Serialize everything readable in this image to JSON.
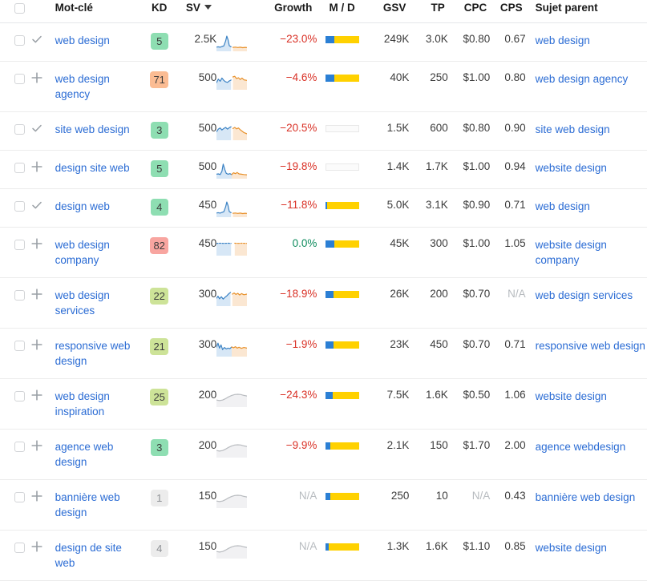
{
  "header": {
    "columns": [
      {
        "key": "keyword",
        "label": "Mot-clé"
      },
      {
        "key": "kd",
        "label": "KD"
      },
      {
        "key": "sv",
        "label": "SV"
      },
      {
        "key": "growth",
        "label": "Growth"
      },
      {
        "key": "md",
        "label": "M / D"
      },
      {
        "key": "gsv",
        "label": "GSV"
      },
      {
        "key": "tp",
        "label": "TP"
      },
      {
        "key": "cpc",
        "label": "CPC"
      },
      {
        "key": "cps",
        "label": "CPS"
      },
      {
        "key": "parent",
        "label": "Sujet parent"
      }
    ],
    "sort_column": "SV",
    "sort_direction": "desc",
    "select_all_checked": false
  },
  "colors": {
    "link": "#2b6cd4",
    "growth_negative": "#d93025",
    "growth_zero": "#0b8a5b",
    "na_text": "#b7bbbf",
    "kd_easy": "#8edeb2",
    "kd_medium_light": "#cde398",
    "kd_hard": "#fbbc93",
    "kd_very_hard": "#f8a5a0",
    "kd_disabled": "#ececec",
    "bar_mobile": "#2b7fd4",
    "bar_desktop": "#ffd100",
    "spark_history": "#3b82c4",
    "spark_forecast": "#e8912b",
    "spark_disabled": "#b9bcc0"
  },
  "rows": [
    {
      "checkbox": false,
      "action_icon": "check-icon",
      "keyword": "web design",
      "kd": "5",
      "kd_style": "kd-green",
      "sv": "2.5K",
      "spark": "spike-flat",
      "spark_style": "color",
      "growth": "−23.0%",
      "growth_style": "growth-neg",
      "md": {
        "mobile_pct": 28,
        "desktop_pct": 72,
        "empty": false
      },
      "gsv": "249K",
      "tp": "3.0K",
      "cpc": "$0.80",
      "cps": "0.67",
      "parent": "web design"
    },
    {
      "checkbox": false,
      "action_icon": "plus-icon",
      "keyword": "web design agency",
      "kd": "71",
      "kd_style": "kd-orange",
      "sv": "500",
      "spark": "wavy-peaks",
      "spark_style": "color",
      "growth": "−4.6%",
      "growth_style": "growth-neg",
      "md": {
        "mobile_pct": 26,
        "desktop_pct": 74,
        "empty": false
      },
      "gsv": "40K",
      "tp": "250",
      "cpc": "$1.00",
      "cps": "0.80",
      "parent": "web design agency"
    },
    {
      "checkbox": false,
      "action_icon": "check-icon",
      "keyword": "site web design",
      "kd": "3",
      "kd_style": "kd-green",
      "sv": "500",
      "spark": "rolling-hills",
      "spark_style": "color",
      "growth": "−20.5%",
      "growth_style": "growth-neg",
      "md": {
        "mobile_pct": 0,
        "desktop_pct": 0,
        "empty": true
      },
      "gsv": "1.5K",
      "tp": "600",
      "cpc": "$0.80",
      "cps": "0.90",
      "parent": "site web design"
    },
    {
      "checkbox": false,
      "action_icon": "plus-icon",
      "keyword": "design site web",
      "kd": "5",
      "kd_style": "kd-green",
      "sv": "500",
      "spark": "spike-low-tail",
      "spark_style": "color",
      "growth": "−19.8%",
      "growth_style": "growth-neg",
      "md": {
        "mobile_pct": 0,
        "desktop_pct": 0,
        "empty": true
      },
      "gsv": "1.4K",
      "tp": "1.7K",
      "cpc": "$1.00",
      "cps": "0.94",
      "parent": "website design"
    },
    {
      "checkbox": false,
      "action_icon": "check-icon",
      "keyword": "design web",
      "kd": "4",
      "kd_style": "kd-green",
      "sv": "450",
      "spark": "spike-flat",
      "spark_style": "color",
      "growth": "−11.8%",
      "growth_style": "growth-neg",
      "md": {
        "mobile_pct": 5,
        "desktop_pct": 95,
        "empty": false
      },
      "gsv": "5.0K",
      "tp": "3.1K",
      "cpc": "$0.90",
      "cps": "0.71",
      "parent": "web design"
    },
    {
      "checkbox": false,
      "action_icon": "plus-icon",
      "keyword": "web design company",
      "kd": "82",
      "kd_style": "kd-red",
      "sv": "450",
      "spark": "flat-dashed",
      "spark_style": "color",
      "growth": "0.0%",
      "growth_style": "growth-zero",
      "md": {
        "mobile_pct": 26,
        "desktop_pct": 74,
        "empty": false
      },
      "gsv": "45K",
      "tp": "300",
      "cpc": "$1.00",
      "cps": "1.05",
      "parent": "website design company"
    },
    {
      "checkbox": false,
      "action_icon": "plus-icon",
      "keyword": "web design services",
      "kd": "22",
      "kd_style": "kd-ltgreen",
      "sv": "300",
      "spark": "jagged-rise",
      "spark_style": "color",
      "growth": "−18.9%",
      "growth_style": "growth-neg",
      "md": {
        "mobile_pct": 24,
        "desktop_pct": 76,
        "empty": false
      },
      "gsv": "26K",
      "tp": "200",
      "cpc": "$0.70",
      "cps": "N/A",
      "cps_style": "na",
      "parent": "web design services"
    },
    {
      "checkbox": false,
      "action_icon": "plus-icon",
      "keyword": "responsive web design",
      "kd": "21",
      "kd_style": "kd-ltgreen",
      "sv": "300",
      "spark": "noisy-decline",
      "spark_style": "color",
      "growth": "−1.9%",
      "growth_style": "growth-neg",
      "md": {
        "mobile_pct": 24,
        "desktop_pct": 76,
        "empty": false
      },
      "gsv": "23K",
      "tp": "450",
      "cpc": "$0.70",
      "cps": "0.71",
      "parent": "responsive web design"
    },
    {
      "checkbox": false,
      "action_icon": "plus-icon",
      "keyword": "web design inspiration",
      "kd": "25",
      "kd_style": "kd-ltgreen",
      "sv": "200",
      "spark": "placeholder-curve",
      "spark_style": "grey",
      "growth": "−24.3%",
      "growth_style": "growth-neg",
      "md": {
        "mobile_pct": 22,
        "desktop_pct": 78,
        "empty": false
      },
      "gsv": "7.5K",
      "tp": "1.6K",
      "cpc": "$0.50",
      "cps": "1.06",
      "parent": "website design"
    },
    {
      "checkbox": false,
      "action_icon": "plus-icon",
      "keyword": "agence web design",
      "kd": "3",
      "kd_style": "kd-green",
      "sv": "200",
      "spark": "placeholder-curve",
      "spark_style": "grey",
      "growth": "−9.9%",
      "growth_style": "growth-neg",
      "md": {
        "mobile_pct": 14,
        "desktop_pct": 86,
        "empty": false
      },
      "gsv": "2.1K",
      "tp": "150",
      "cpc": "$1.70",
      "cps": "2.00",
      "parent": "agence webdesign"
    },
    {
      "checkbox": false,
      "action_icon": "plus-icon",
      "keyword": "bannière web design",
      "kd": "1",
      "kd_style": "kd-grey",
      "sv": "150",
      "spark": "placeholder-curve",
      "spark_style": "grey",
      "growth": "N/A",
      "growth_style": "na",
      "md": {
        "mobile_pct": 14,
        "desktop_pct": 86,
        "empty": false
      },
      "gsv": "250",
      "tp": "10",
      "cpc": "N/A",
      "cpc_style": "na",
      "cps": "0.43",
      "parent": "bannière web design"
    },
    {
      "checkbox": false,
      "action_icon": "plus-icon",
      "keyword": "design de site web",
      "kd": "4",
      "kd_style": "kd-grey",
      "sv": "150",
      "spark": "placeholder-curve",
      "spark_style": "grey",
      "growth": "N/A",
      "growth_style": "na",
      "md": {
        "mobile_pct": 10,
        "desktop_pct": 90,
        "empty": false
      },
      "gsv": "1.3K",
      "tp": "1.6K",
      "cpc": "$1.10",
      "cps": "0.85",
      "parent": "website design"
    }
  ]
}
